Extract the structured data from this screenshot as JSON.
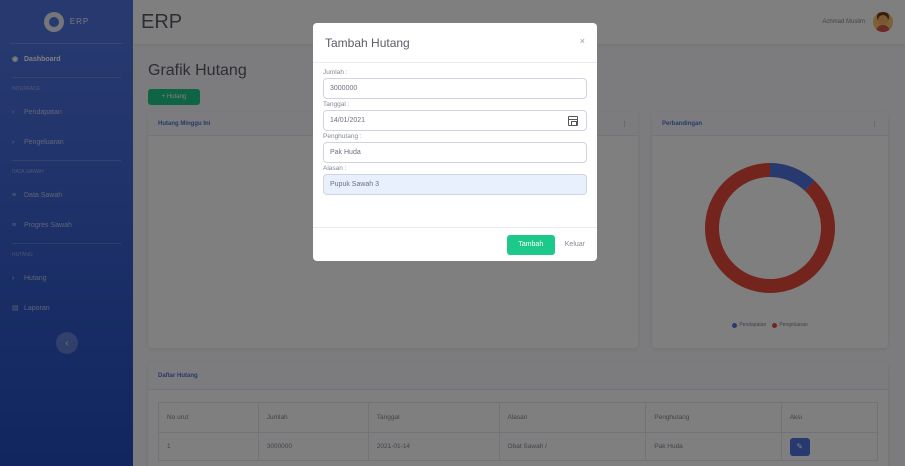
{
  "sidebar": {
    "brand": "ERP",
    "items": [
      {
        "type": "item",
        "label": "Dashboard",
        "icon": "tachometer-icon",
        "active": true
      },
      {
        "type": "heading",
        "label": "Interface"
      },
      {
        "type": "item",
        "label": "Pendapatan",
        "icon": "chevron-right-icon"
      },
      {
        "type": "item",
        "label": "Pengeluaran",
        "icon": "chevron-right-icon"
      },
      {
        "type": "heading",
        "label": "Data Sawah"
      },
      {
        "type": "item",
        "label": "Data Sawah",
        "icon": "list-icon"
      },
      {
        "type": "item",
        "label": "Progres Sawah",
        "icon": "list-icon"
      },
      {
        "type": "heading",
        "label": "Hutang"
      },
      {
        "type": "item",
        "label": "Hutang",
        "icon": "chevron-right-icon"
      },
      {
        "type": "item",
        "label": "Laporan",
        "icon": "file-icon"
      }
    ],
    "toggle_icon": "‹"
  },
  "topbar": {
    "title": "ERP",
    "user_name": "Achmad Muslim"
  },
  "page": {
    "title": "Grafik Hutang",
    "add_button": "+ Hutang"
  },
  "cards": {
    "bar_title": "Hutang Minggu Ini",
    "pie_title": "Perbandingan",
    "menu_icon": "⋮",
    "table_title": "Daftar Hutang"
  },
  "chart_data": {
    "type": "pie",
    "labels": [
      "Pendapatan",
      "Pengeluaran"
    ],
    "values": [
      12,
      88
    ],
    "colors": [
      "#4e73df",
      "#e74a3b"
    ]
  },
  "table": {
    "columns": [
      "No urut",
      "Jumlah",
      "Tanggal",
      "Alasan",
      "Penghutang",
      "Aksi"
    ],
    "rows": [
      [
        "1",
        "3000000",
        "2021-01-14",
        "Obat Sawah /",
        "Pak Huda"
      ]
    ],
    "action_icon": "✎"
  },
  "modal": {
    "title": "Tambah Hutang",
    "close": "×",
    "fields": [
      {
        "label": "Jumlah :",
        "value": "3000000"
      },
      {
        "label": "Tanggal :",
        "value": "14/01/2021"
      },
      {
        "label": "Penghutang :",
        "value": "Pak Huda"
      },
      {
        "label": "Alasan :",
        "value": "Pupuk Sawah 3"
      }
    ],
    "submit": "Tambah",
    "cancel": "Keluar"
  },
  "colors": {
    "primary": "#4e73df",
    "success": "#1cc88a",
    "danger": "#e74a3b"
  }
}
